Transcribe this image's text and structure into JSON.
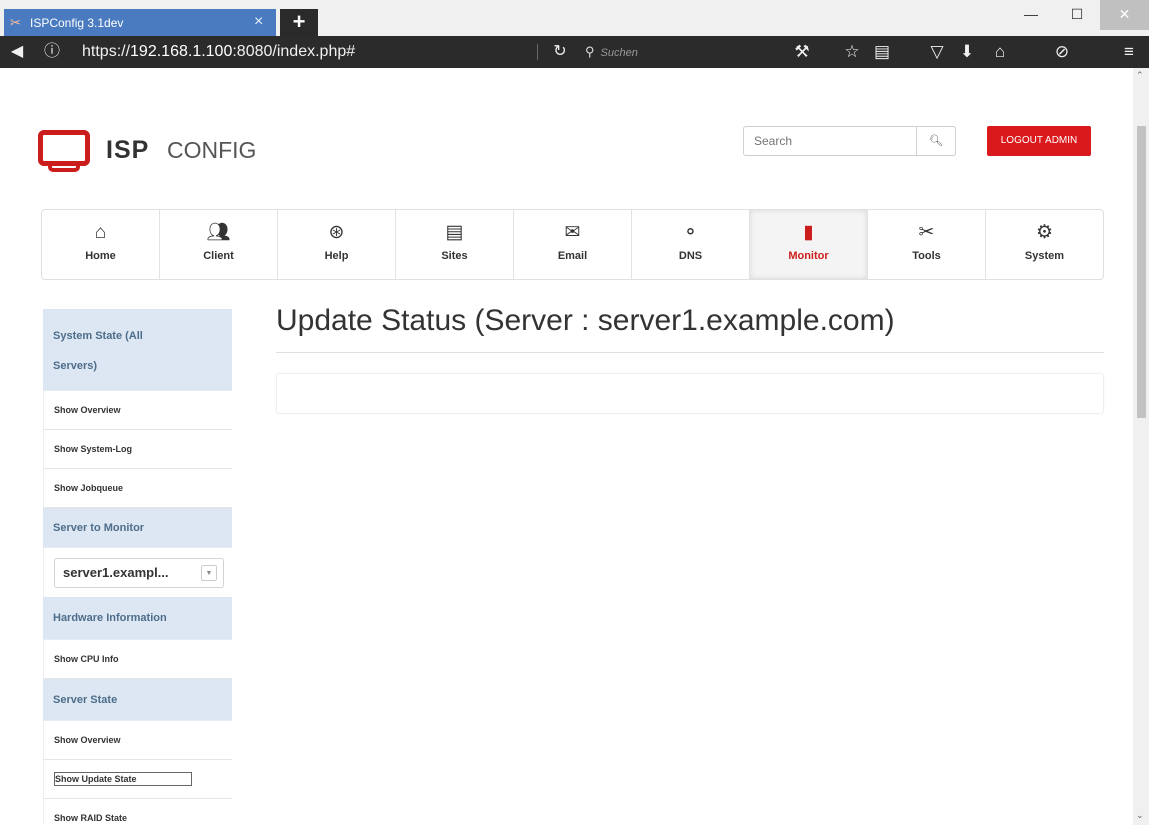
{
  "browser": {
    "tab_title": "ISPConfig 3.1dev",
    "tab_close": "×",
    "new_tab": "+",
    "url_prefix": "https://",
    "url_host": "192.168.1.100",
    "url_rest": ":8080/index.php#",
    "search_placeholder": "Suchen"
  },
  "header": {
    "logo_isp": "ISP",
    "logo_config": "CONFIG",
    "search_placeholder": "Search",
    "logout_label": "LOGOUT ADMIN"
  },
  "nav": {
    "items": [
      {
        "label": "Home",
        "icon": "home-icon"
      },
      {
        "label": "Client",
        "icon": "client-icon"
      },
      {
        "label": "Help",
        "icon": "help-icon"
      },
      {
        "label": "Sites",
        "icon": "sites-icon"
      },
      {
        "label": "Email",
        "icon": "email-icon"
      },
      {
        "label": "DNS",
        "icon": "dns-icon"
      },
      {
        "label": "Monitor",
        "icon": "monitor-icon"
      },
      {
        "label": "Tools",
        "icon": "tools-icon"
      },
      {
        "label": "System",
        "icon": "system-icon"
      }
    ],
    "active": "Monitor"
  },
  "sidebar": {
    "head_system_state_line1": "System State (All",
    "head_system_state_line2": "Servers)",
    "show_overview": "Show Overview",
    "show_system_log": "Show System-Log",
    "show_jobqueue": "Show Jobqueue",
    "head_server_to_monitor": "Server to Monitor",
    "server_select_value": "server1.exampl...",
    "head_hardware_information": "Hardware Information",
    "show_cpu_info": "Show CPU Info",
    "head_server_state": "Server State",
    "show_overview_2": "Show Overview",
    "show_update_state": "Show Update State",
    "show_raid_state": "Show RAID State"
  },
  "main": {
    "title": "Update Status (Server : server1.example.com)"
  },
  "colors": {
    "accent_red": "#d9191c",
    "tab_blue": "#4a7bc1",
    "sidebar_head_bg": "#dde7f3"
  }
}
